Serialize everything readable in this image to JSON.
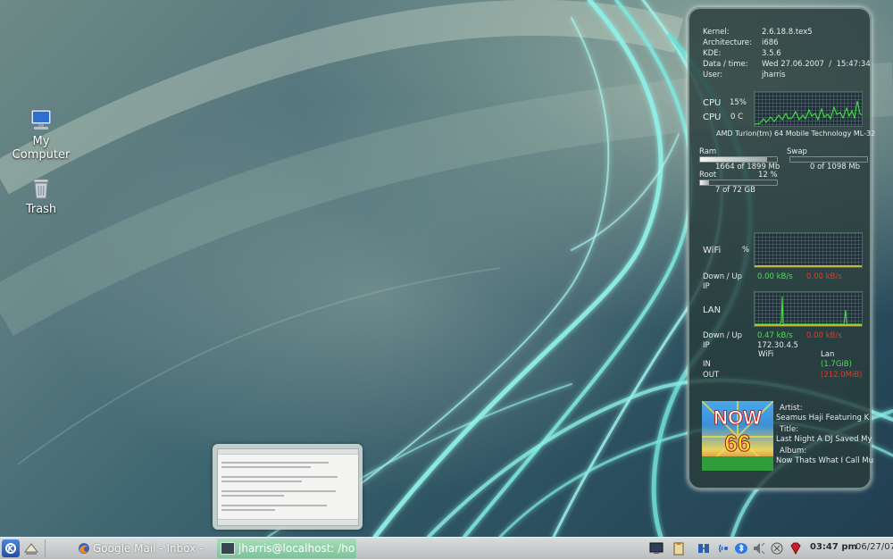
{
  "desktop": {
    "icons": [
      {
        "label": "My\nComputer",
        "icon": "computer-icon"
      },
      {
        "label": "Trash",
        "icon": "trash-icon"
      }
    ]
  },
  "sysinfo": {
    "kernel_label": "Kernel:",
    "kernel": "2.6.18.8.tex5",
    "arch_label": "Architecture:",
    "arch": "i686",
    "kde_label": "KDE:",
    "kde": "3.5.6",
    "datetime_label": "Data / time:",
    "datetime": "Wed 27.06.2007  /  15:47:34",
    "user_label": "User:",
    "user": "jharris"
  },
  "cpu": {
    "label1": "CPU",
    "usage": "15%",
    "label2": "CPU",
    "temp": "0 C",
    "model": "AMD Turion(tm) 64 Mobile Technology ML-32"
  },
  "memory": {
    "ram_label": "Ram",
    "ram_value": "1664 of 1899 Mb",
    "ram_fraction": 0.876,
    "swap_label": "Swap",
    "swap_value": "0 of 1098 Mb",
    "swap_fraction": 0.0,
    "root_label": "Root",
    "root_percent": "12 %",
    "root_value": "7 of 72 GB",
    "root_fraction": 0.12
  },
  "wifi": {
    "label": "WiFi",
    "percent": "%",
    "downup_label": "Down / Up",
    "down": "0.00 kB/s",
    "up": "0.00 kB/s",
    "ip_label": "IP"
  },
  "lan": {
    "label": "LAN",
    "downup_label": "Down / Up",
    "down": "0.47 kB/s",
    "up": "0.00 kB/s",
    "ip_label": "IP",
    "ip": "172.30.4.5"
  },
  "traffic": {
    "wifi_header": "WiFi",
    "lan_header": "Lan",
    "in_label": "IN",
    "out_label": "OUT",
    "lan_in": "(1.7GiB)",
    "lan_out": "(212.0MiB)"
  },
  "music": {
    "artist_label": "Artist:",
    "artist": "Seamus Haji Featuring K",
    "title_label": "Title:",
    "title": "Last Night A DJ Saved My",
    "album_label": "Album:",
    "album": "Now Thats What I Call Mu",
    "cover_text": "NOW",
    "cover_number": "66"
  },
  "taskbar": {
    "task1": "Google Mail - Inbox - ",
    "task2": "jharris@localhost: /ho",
    "clock_time": "03:47 pm",
    "clock_date": "06/27/07"
  },
  "colors": {
    "accent_green": "#48e24a",
    "accent_red": "#e23b2a",
    "taskbar_active": "#8fd0a5"
  }
}
